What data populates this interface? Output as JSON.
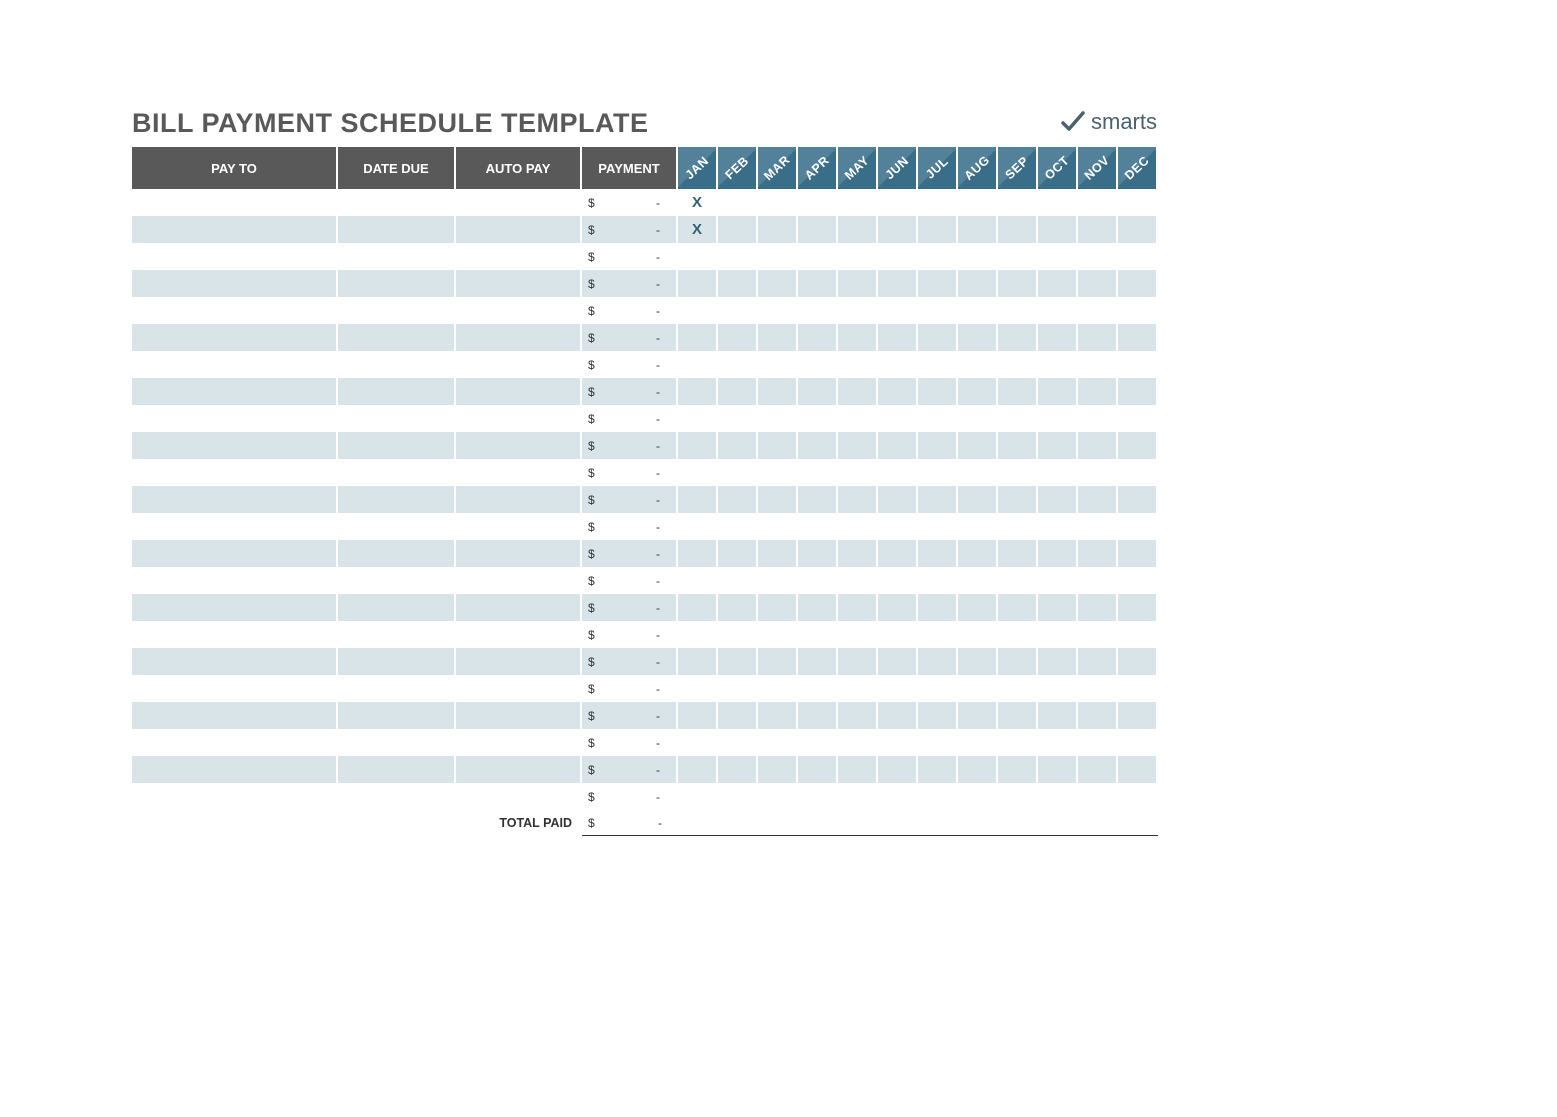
{
  "title": "BILL PAYMENT SCHEDULE TEMPLATE",
  "brand": "smarts",
  "columns": {
    "pay_to": "PAY TO",
    "date_due": "DATE DUE",
    "auto_pay": "AUTO PAY",
    "payment": "PAYMENT"
  },
  "months": [
    "JAN",
    "FEB",
    "MAR",
    "APR",
    "MAY",
    "JUN",
    "JUL",
    "AUG",
    "SEP",
    "OCT",
    "NOV",
    "DEC"
  ],
  "rows": [
    {
      "pay_to": "",
      "date_due": "",
      "auto_pay": "",
      "payment_symbol": "$",
      "payment_value": "-",
      "months": [
        "X",
        "",
        "",
        "",
        "",
        "",
        "",
        "",
        "",
        "",
        "",
        ""
      ]
    },
    {
      "pay_to": "",
      "date_due": "",
      "auto_pay": "",
      "payment_symbol": "$",
      "payment_value": "-",
      "months": [
        "X",
        "",
        "",
        "",
        "",
        "",
        "",
        "",
        "",
        "",
        "",
        ""
      ]
    },
    {
      "pay_to": "",
      "date_due": "",
      "auto_pay": "",
      "payment_symbol": "$",
      "payment_value": "-",
      "months": [
        "",
        "",
        "",
        "",
        "",
        "",
        "",
        "",
        "",
        "",
        "",
        ""
      ]
    },
    {
      "pay_to": "",
      "date_due": "",
      "auto_pay": "",
      "payment_symbol": "$",
      "payment_value": "-",
      "months": [
        "",
        "",
        "",
        "",
        "",
        "",
        "",
        "",
        "",
        "",
        "",
        ""
      ]
    },
    {
      "pay_to": "",
      "date_due": "",
      "auto_pay": "",
      "payment_symbol": "$",
      "payment_value": "-",
      "months": [
        "",
        "",
        "",
        "",
        "",
        "",
        "",
        "",
        "",
        "",
        "",
        ""
      ]
    },
    {
      "pay_to": "",
      "date_due": "",
      "auto_pay": "",
      "payment_symbol": "$",
      "payment_value": "-",
      "months": [
        "",
        "",
        "",
        "",
        "",
        "",
        "",
        "",
        "",
        "",
        "",
        ""
      ]
    },
    {
      "pay_to": "",
      "date_due": "",
      "auto_pay": "",
      "payment_symbol": "$",
      "payment_value": "-",
      "months": [
        "",
        "",
        "",
        "",
        "",
        "",
        "",
        "",
        "",
        "",
        "",
        ""
      ]
    },
    {
      "pay_to": "",
      "date_due": "",
      "auto_pay": "",
      "payment_symbol": "$",
      "payment_value": "-",
      "months": [
        "",
        "",
        "",
        "",
        "",
        "",
        "",
        "",
        "",
        "",
        "",
        ""
      ]
    },
    {
      "pay_to": "",
      "date_due": "",
      "auto_pay": "",
      "payment_symbol": "$",
      "payment_value": "-",
      "months": [
        "",
        "",
        "",
        "",
        "",
        "",
        "",
        "",
        "",
        "",
        "",
        ""
      ]
    },
    {
      "pay_to": "",
      "date_due": "",
      "auto_pay": "",
      "payment_symbol": "$",
      "payment_value": "-",
      "months": [
        "",
        "",
        "",
        "",
        "",
        "",
        "",
        "",
        "",
        "",
        "",
        ""
      ]
    },
    {
      "pay_to": "",
      "date_due": "",
      "auto_pay": "",
      "payment_symbol": "$",
      "payment_value": "-",
      "months": [
        "",
        "",
        "",
        "",
        "",
        "",
        "",
        "",
        "",
        "",
        "",
        ""
      ]
    },
    {
      "pay_to": "",
      "date_due": "",
      "auto_pay": "",
      "payment_symbol": "$",
      "payment_value": "-",
      "months": [
        "",
        "",
        "",
        "",
        "",
        "",
        "",
        "",
        "",
        "",
        "",
        ""
      ]
    },
    {
      "pay_to": "",
      "date_due": "",
      "auto_pay": "",
      "payment_symbol": "$",
      "payment_value": "-",
      "months": [
        "",
        "",
        "",
        "",
        "",
        "",
        "",
        "",
        "",
        "",
        "",
        ""
      ]
    },
    {
      "pay_to": "",
      "date_due": "",
      "auto_pay": "",
      "payment_symbol": "$",
      "payment_value": "-",
      "months": [
        "",
        "",
        "",
        "",
        "",
        "",
        "",
        "",
        "",
        "",
        "",
        ""
      ]
    },
    {
      "pay_to": "",
      "date_due": "",
      "auto_pay": "",
      "payment_symbol": "$",
      "payment_value": "-",
      "months": [
        "",
        "",
        "",
        "",
        "",
        "",
        "",
        "",
        "",
        "",
        "",
        ""
      ]
    },
    {
      "pay_to": "",
      "date_due": "",
      "auto_pay": "",
      "payment_symbol": "$",
      "payment_value": "-",
      "months": [
        "",
        "",
        "",
        "",
        "",
        "",
        "",
        "",
        "",
        "",
        "",
        ""
      ]
    },
    {
      "pay_to": "",
      "date_due": "",
      "auto_pay": "",
      "payment_symbol": "$",
      "payment_value": "-",
      "months": [
        "",
        "",
        "",
        "",
        "",
        "",
        "",
        "",
        "",
        "",
        "",
        ""
      ]
    },
    {
      "pay_to": "",
      "date_due": "",
      "auto_pay": "",
      "payment_symbol": "$",
      "payment_value": "-",
      "months": [
        "",
        "",
        "",
        "",
        "",
        "",
        "",
        "",
        "",
        "",
        "",
        ""
      ]
    },
    {
      "pay_to": "",
      "date_due": "",
      "auto_pay": "",
      "payment_symbol": "$",
      "payment_value": "-",
      "months": [
        "",
        "",
        "",
        "",
        "",
        "",
        "",
        "",
        "",
        "",
        "",
        ""
      ]
    },
    {
      "pay_to": "",
      "date_due": "",
      "auto_pay": "",
      "payment_symbol": "$",
      "payment_value": "-",
      "months": [
        "",
        "",
        "",
        "",
        "",
        "",
        "",
        "",
        "",
        "",
        "",
        ""
      ]
    },
    {
      "pay_to": "",
      "date_due": "",
      "auto_pay": "",
      "payment_symbol": "$",
      "payment_value": "-",
      "months": [
        "",
        "",
        "",
        "",
        "",
        "",
        "",
        "",
        "",
        "",
        "",
        ""
      ]
    },
    {
      "pay_to": "",
      "date_due": "",
      "auto_pay": "",
      "payment_symbol": "$",
      "payment_value": "-",
      "months": [
        "",
        "",
        "",
        "",
        "",
        "",
        "",
        "",
        "",
        "",
        "",
        ""
      ]
    },
    {
      "pay_to": "",
      "date_due": "",
      "auto_pay": "",
      "payment_symbol": "$",
      "payment_value": "-",
      "months": [
        "",
        "",
        "",
        "",
        "",
        "",
        "",
        "",
        "",
        "",
        "",
        ""
      ]
    }
  ],
  "total": {
    "label": "TOTAL PAID",
    "symbol": "$",
    "value": "-"
  },
  "colors": {
    "header_dark": "#595959",
    "month_bg": "#3a6e88",
    "row_alt": "#d8e4e8",
    "accent": "#316079"
  }
}
